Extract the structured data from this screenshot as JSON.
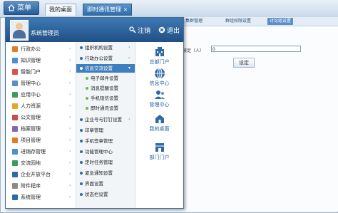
{
  "topbar": {
    "start_label": "菜单",
    "tabs": [
      {
        "label": "我的桌面",
        "active": false
      },
      {
        "label": "即时通讯管理",
        "active": true
      }
    ]
  },
  "subtabs": [
    {
      "label": "集群管理",
      "active": false
    },
    {
      "label": "群组权限设置",
      "active": false
    },
    {
      "label": "讨论组设置",
      "active": true
    }
  ],
  "form": {
    "label": "限定（人）",
    "input_value": "0",
    "button_label": "设定"
  },
  "menu": {
    "user_name": "系统管理员",
    "logout_label": "注销",
    "exit_label": "退出",
    "col1": [
      {
        "label": "行政办公",
        "icon": "office-icon",
        "color": "#e07b2a"
      },
      {
        "label": "知识管理",
        "icon": "knowledge-icon",
        "color": "#4a8fd1"
      },
      {
        "label": "智能门户",
        "icon": "portal-icon",
        "color": "#d9534f"
      },
      {
        "label": "管理中心",
        "icon": "admin-icon",
        "color": "#5b8fc3"
      },
      {
        "label": "应用中心",
        "icon": "apps-icon",
        "color": "#3c9a5f"
      },
      {
        "label": "人力资源",
        "icon": "hr-icon",
        "color": "#e5a72b"
      },
      {
        "label": "公文管理",
        "icon": "document-icon",
        "color": "#c0504d"
      },
      {
        "label": "档案管理",
        "icon": "archive-icon",
        "color": "#7f6bb3"
      },
      {
        "label": "项目管理",
        "icon": "project-icon",
        "color": "#e07b2a"
      },
      {
        "label": "进销存管理",
        "icon": "inventory-icon",
        "color": "#4a8fd1"
      },
      {
        "label": "交流园地",
        "icon": "forum-icon",
        "color": "#3c9a5f"
      },
      {
        "label": "企业开放平台",
        "icon": "platform-icon",
        "color": "#2f6aa6"
      },
      {
        "label": "附件程序",
        "icon": "attachment-icon",
        "color": "#8a8a8a"
      },
      {
        "label": "系统管理",
        "icon": "system-icon",
        "color": "#2f6aa6"
      }
    ],
    "col2": [
      {
        "label": "组织机构设置",
        "type": "item",
        "arrow": true
      },
      {
        "label": "行政办公设置",
        "type": "item",
        "arrow": true
      },
      {
        "label": "信息交流设置",
        "type": "active",
        "arrow": true
      },
      {
        "label": "电子邮件设置",
        "type": "sub",
        "arrow": false
      },
      {
        "label": "消息提醒设置",
        "type": "sub",
        "arrow": false
      },
      {
        "label": "手机短信设置",
        "type": "sub",
        "arrow": false
      },
      {
        "label": "即时通讯设置",
        "type": "sub",
        "arrow": false
      },
      {
        "label": "企业号与钉钉设置",
        "type": "item",
        "arrow": true
      },
      {
        "label": "印章管理",
        "type": "item",
        "arrow": false
      },
      {
        "label": "手机签章管理",
        "type": "item",
        "arrow": false
      },
      {
        "label": "功能管理中心",
        "type": "item",
        "arrow": false
      },
      {
        "label": "定时任务管理",
        "type": "item",
        "arrow": false
      },
      {
        "label": "紧急通知设置",
        "type": "item",
        "arrow": false
      },
      {
        "label": "界面设置",
        "type": "item",
        "arrow": false
      },
      {
        "label": "状态栏设置",
        "type": "item",
        "arrow": false
      }
    ],
    "col3": [
      {
        "label": "总部门户",
        "icon": "headquarters-icon"
      },
      {
        "label": "信息中心",
        "icon": "info-center-icon"
      },
      {
        "label": "管理中心",
        "icon": "management-icon"
      },
      {
        "label": "我的桌面",
        "icon": "desktop-icon"
      },
      {
        "label": "部门门户",
        "icon": "department-icon"
      }
    ]
  }
}
